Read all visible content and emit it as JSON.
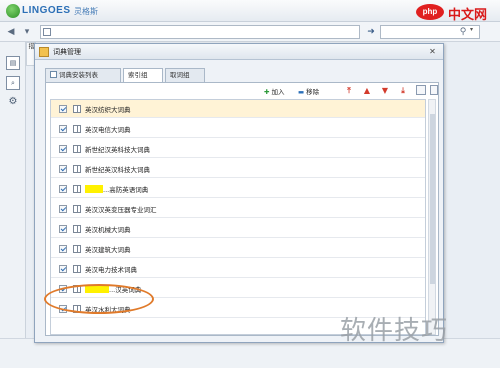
{
  "app": {
    "brand": "LINGOES",
    "brand_sub": "灵格斯",
    "address_value": "",
    "search_value": ""
  },
  "left_strip": {
    "tab_label": "搭",
    "icons": [
      "dict-icon",
      "search-icon",
      "settings-icon"
    ]
  },
  "dialog": {
    "title": "词典管理",
    "close_symbol": "✕",
    "tabs": [
      {
        "label": "词典安装列表",
        "active": false
      },
      {
        "label": "索引组",
        "active": true
      },
      {
        "label": "取词组",
        "active": false
      }
    ],
    "toolbar": {
      "add_label": "加入",
      "remove_label": "移除"
    },
    "rows": [
      {
        "label": "英汉纺织大词典",
        "checked": true,
        "highlight": true,
        "redacted": false
      },
      {
        "label": "英汉电信大词典",
        "checked": true,
        "highlight": false,
        "redacted": false
      },
      {
        "label": "新世纪汉英科技大词典",
        "checked": true,
        "highlight": false,
        "redacted": false
      },
      {
        "label": "新世纪英汉科技大词典",
        "checked": true,
        "highlight": false,
        "redacted": false
      },
      {
        "label": "...高防英语词典",
        "checked": true,
        "highlight": false,
        "redacted": true
      },
      {
        "label": "英汉汉英变压器专业词汇",
        "checked": true,
        "highlight": false,
        "redacted": false
      },
      {
        "label": "英汉机械大词典",
        "checked": true,
        "highlight": false,
        "redacted": false
      },
      {
        "label": "英汉建筑大词典",
        "checked": true,
        "highlight": false,
        "redacted": false
      },
      {
        "label": "英汉电力技术词典",
        "checked": true,
        "highlight": false,
        "redacted": false
      },
      {
        "label": "...汉英词典",
        "checked": true,
        "highlight": false,
        "redacted": true
      },
      {
        "label": "英汉水利大词典",
        "checked": true,
        "highlight": false,
        "redacted": false
      }
    ]
  },
  "watermark": {
    "logo_oval": "php",
    "logo_text": "中文网",
    "bottom_text": "软件技巧"
  },
  "colors": {
    "highlight_row": "#fff3d6",
    "annotation": "#e07a2a",
    "arrow_buttons": "#d33b2c"
  }
}
